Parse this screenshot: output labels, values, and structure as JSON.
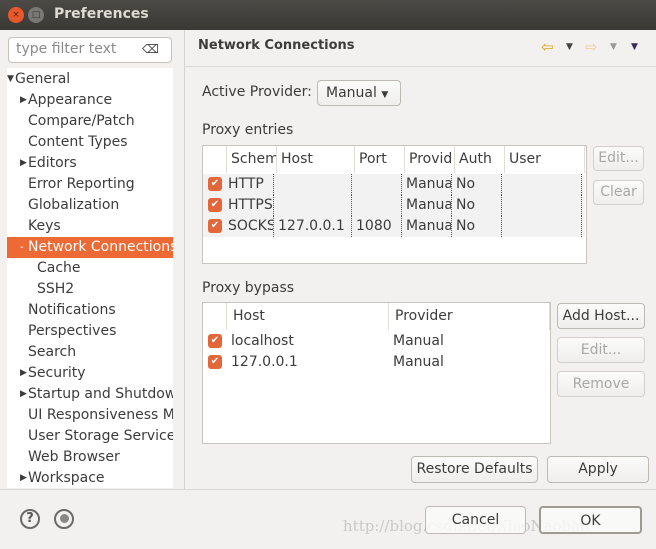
{
  "window": {
    "title": "Preferences",
    "close_icon": "close-icon",
    "maximize_icon": "maximize-icon"
  },
  "sidebar": {
    "filter_placeholder": "type filter text",
    "items": [
      {
        "label": "General",
        "level": 0,
        "expanded": true
      },
      {
        "label": "Appearance",
        "level": 1,
        "has_children": true
      },
      {
        "label": "Compare/Patch",
        "level": 1
      },
      {
        "label": "Content Types",
        "level": 1
      },
      {
        "label": "Editors",
        "level": 1,
        "has_children": true
      },
      {
        "label": "Error Reporting",
        "level": 1
      },
      {
        "label": "Globalization",
        "level": 1
      },
      {
        "label": "Keys",
        "level": 1
      },
      {
        "label": "Network Connections",
        "level": 1,
        "selected": true,
        "expanded": true
      },
      {
        "label": "Cache",
        "level": 2
      },
      {
        "label": "SSH2",
        "level": 2
      },
      {
        "label": "Notifications",
        "level": 1
      },
      {
        "label": "Perspectives",
        "level": 1
      },
      {
        "label": "Search",
        "level": 1
      },
      {
        "label": "Security",
        "level": 1,
        "has_children": true
      },
      {
        "label": "Startup and Shutdown",
        "level": 1,
        "has_children": true
      },
      {
        "label": "UI Responsiveness Monitoring",
        "level": 1
      },
      {
        "label": "User Storage Service",
        "level": 1
      },
      {
        "label": "Web Browser",
        "level": 1
      },
      {
        "label": "Workspace",
        "level": 1,
        "has_children": true
      }
    ]
  },
  "main": {
    "title": "Network Connections",
    "active_provider_label": "Active Provider:",
    "active_provider_value": "Manual",
    "proxy_entries_label": "Proxy entries",
    "proxy_columns": [
      "Schem",
      "Host",
      "Port",
      "Provid",
      "Auth",
      "User"
    ],
    "proxy_rows": [
      {
        "checked": true,
        "scheme": "HTTP",
        "host": "",
        "port": "",
        "provider": "Manua",
        "auth": "No",
        "user": ""
      },
      {
        "checked": true,
        "scheme": "HTTPS",
        "host": "",
        "port": "",
        "provider": "Manua",
        "auth": "No",
        "user": ""
      },
      {
        "checked": true,
        "scheme": "SOCKS",
        "host": "127.0.0.1",
        "port": "1080",
        "provider": "Manua",
        "auth": "No",
        "user": ""
      }
    ],
    "entries_edit": "Edit...",
    "entries_clear": "Clear",
    "bypass_label": "Proxy bypass",
    "bypass_columns": [
      "Host",
      "Provider"
    ],
    "bypass_rows": [
      {
        "checked": true,
        "host": "localhost",
        "provider": "Manual"
      },
      {
        "checked": true,
        "host": "127.0.0.1",
        "provider": "Manual"
      }
    ],
    "add_host": "Add Host...",
    "bypass_edit": "Edit...",
    "bypass_remove": "Remove",
    "restore_defaults": "Restore Defaults",
    "apply": "Apply"
  },
  "footer": {
    "cancel": "Cancel",
    "ok": "OK",
    "help_icon": "?"
  },
  "watermark": "http://blog.csdn.net/XiaoNaoban",
  "colors": {
    "accent": "#ee6a34",
    "titlebar": "#3c3b37"
  }
}
